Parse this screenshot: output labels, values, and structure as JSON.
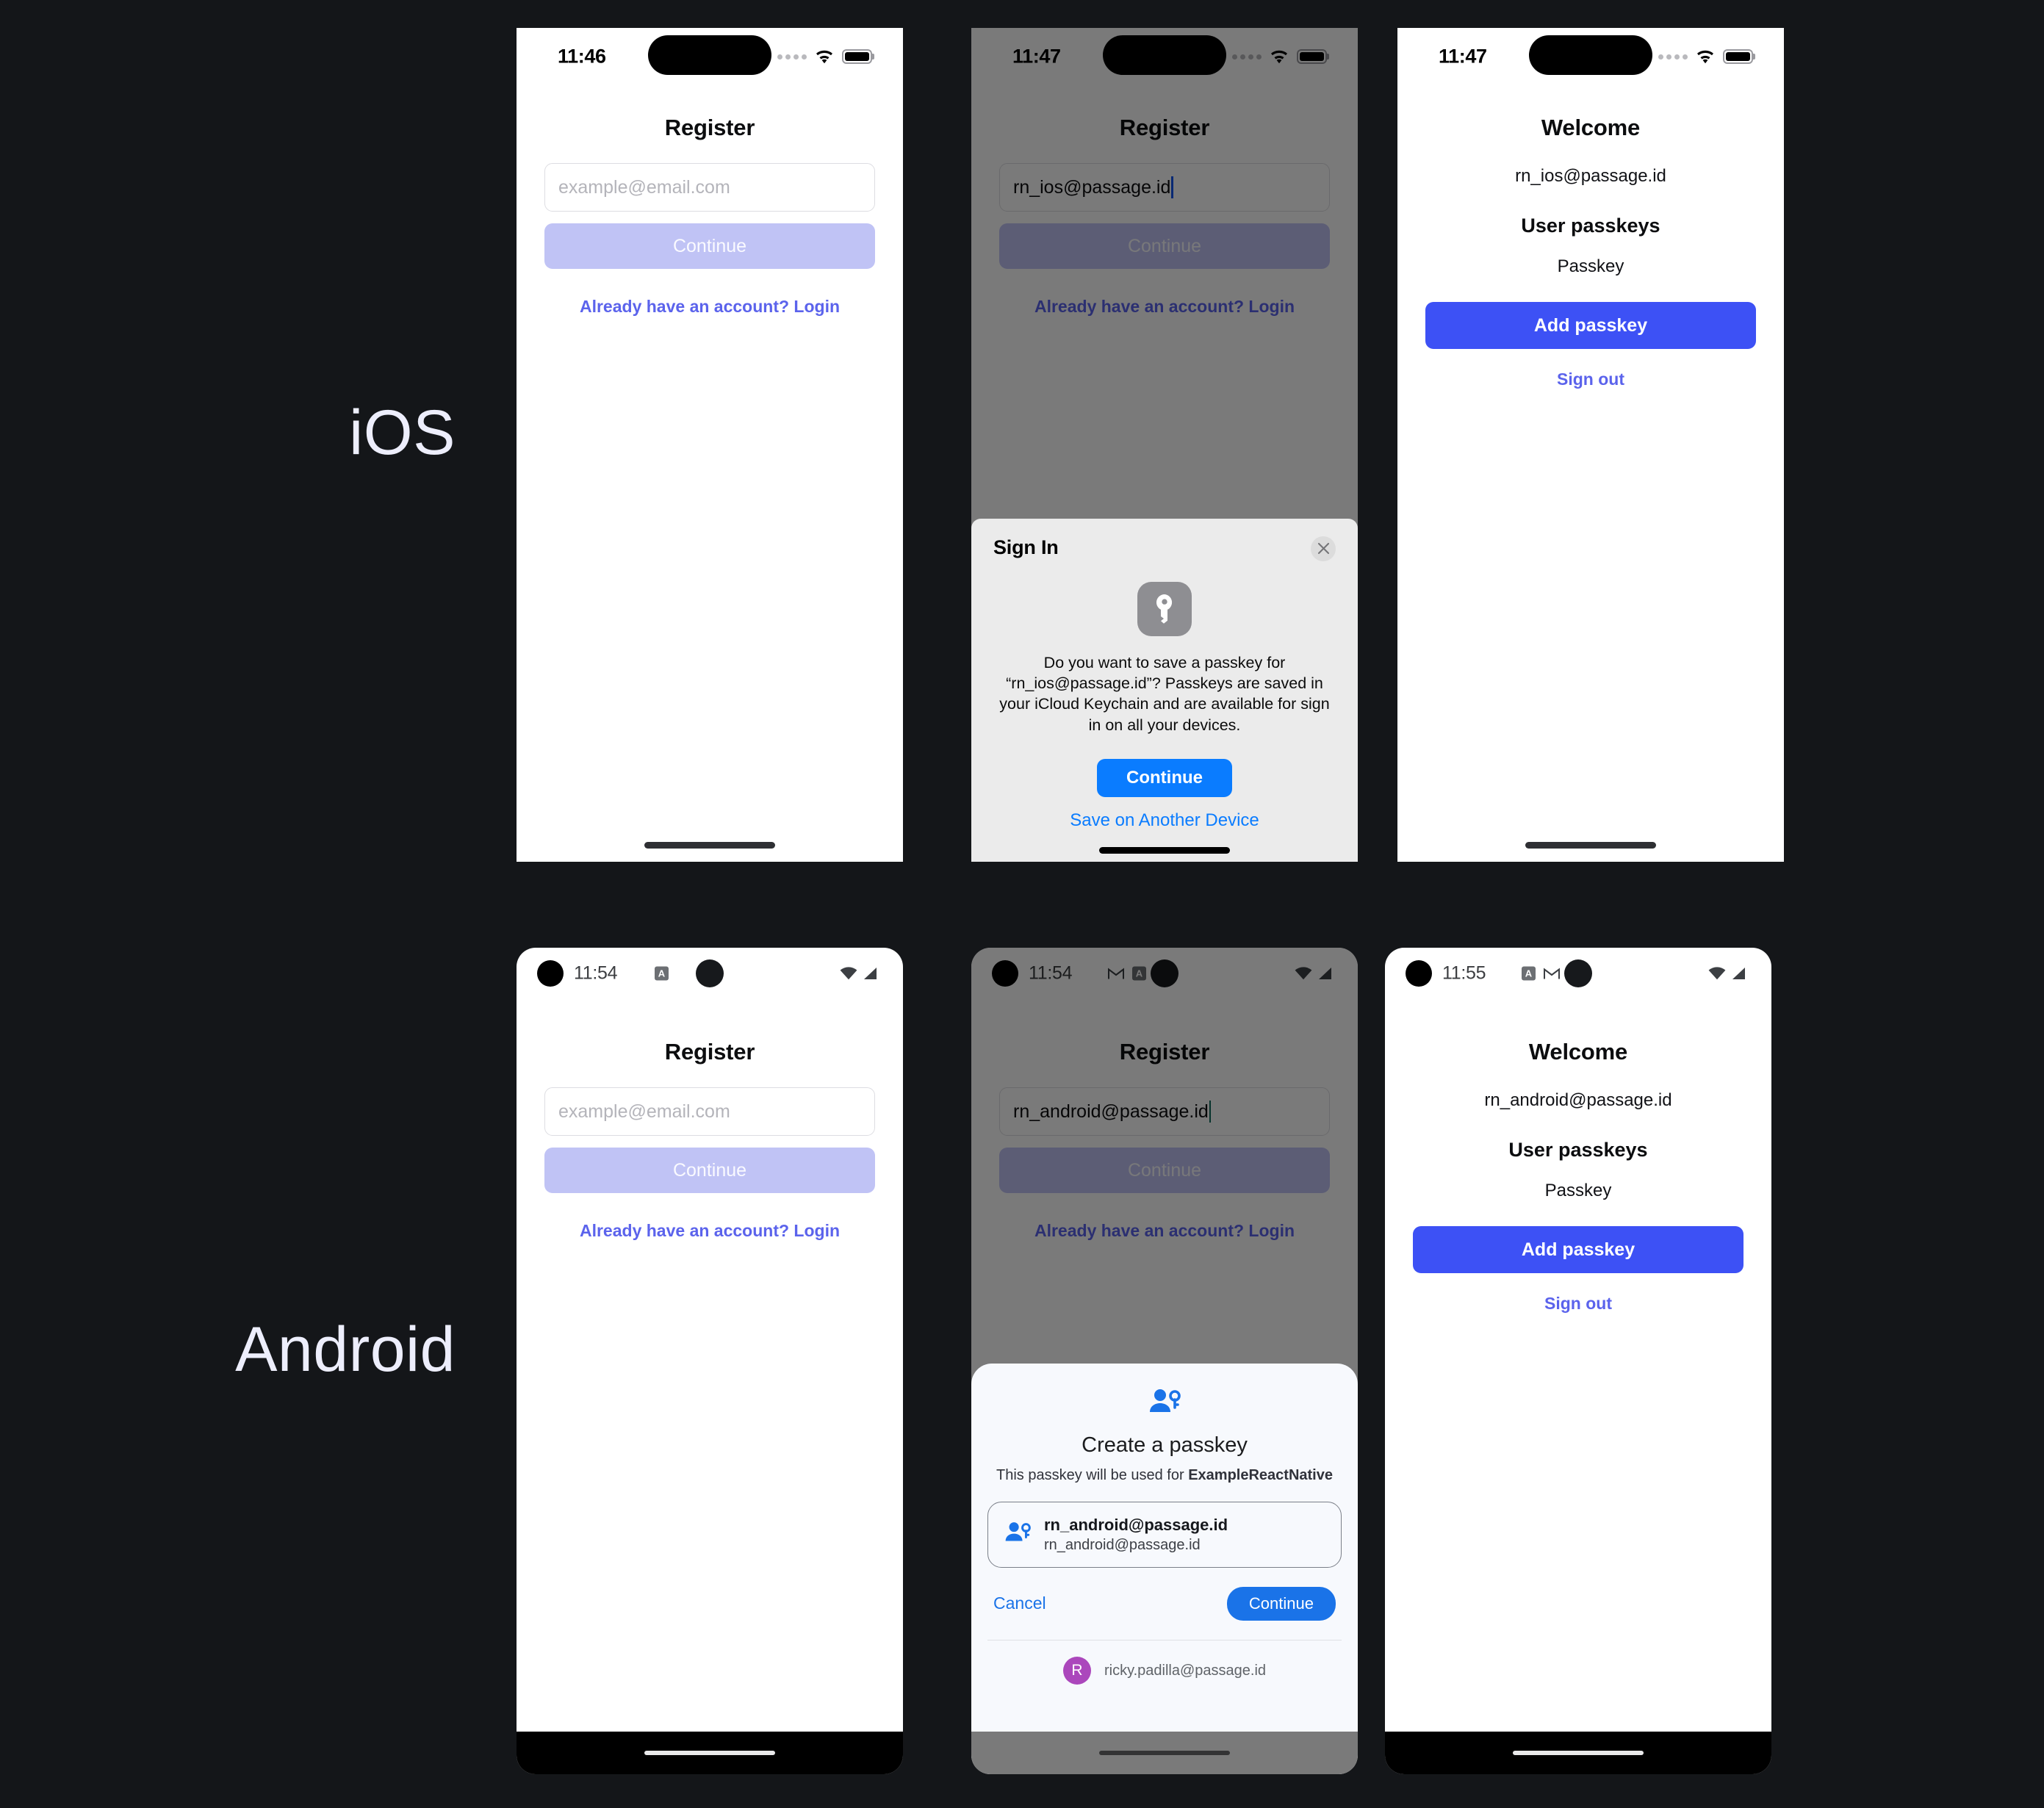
{
  "labels": {
    "ios": "iOS",
    "android": "Android"
  },
  "colors": {
    "page_background": "#141619",
    "primary_button": "#3d51f5",
    "disabled_button": "#c0c3f5",
    "link": "#5b63ec",
    "ios_blue": "#0a7cff",
    "android_blue": "#1a73e8",
    "avatar": "#ab47bc"
  },
  "ios": {
    "register_empty": {
      "status": {
        "time": "11:46",
        "wifi_icon": "wifi-icon",
        "battery_icon": "battery-icon",
        "cellular_icon": "cellular-dots-icon"
      },
      "title": "Register",
      "email_placeholder": "example@email.com",
      "email_value": "",
      "continue_label": "Continue",
      "login_link": "Already have an account? Login"
    },
    "register_filled": {
      "status": {
        "time": "11:47",
        "wifi_icon": "wifi-icon",
        "battery_icon": "battery-icon",
        "cellular_icon": "cellular-dots-icon"
      },
      "title": "Register",
      "email_placeholder": "example@email.com",
      "email_value": "rn_ios@passage.id",
      "continue_label": "Continue",
      "login_link": "Already have an account? Login",
      "sheet": {
        "title": "Sign In",
        "close_icon": "close-icon",
        "key_icon": "passkey-key-icon",
        "message": "Do you want to save a passkey for “rn_ios@passage.id”? Passkeys are saved in your iCloud Keychain and are available for sign in on all your devices.",
        "continue_label": "Continue",
        "alt_label": "Save on Another Device"
      }
    },
    "welcome": {
      "status": {
        "time": "11:47",
        "wifi_icon": "wifi-icon",
        "battery_icon": "battery-icon",
        "cellular_icon": "cellular-dots-icon"
      },
      "title": "Welcome",
      "email": "rn_ios@passage.id",
      "section_title": "User passkeys",
      "passkey_item": "Passkey",
      "add_passkey_label": "Add passkey",
      "sign_out_label": "Sign out"
    }
  },
  "android": {
    "register_empty": {
      "status": {
        "time": "11:54",
        "badges": [
          "app-badge-icon"
        ],
        "wifi_icon": "wifi-icon",
        "signal_icon": "signal-icon"
      },
      "title": "Register",
      "email_placeholder": "example@email.com",
      "email_value": "",
      "continue_label": "Continue",
      "login_link": "Already have an account? Login"
    },
    "register_filled": {
      "status": {
        "time": "11:54",
        "badges": [
          "gmail-icon",
          "app-badge-icon"
        ],
        "wifi_icon": "wifi-icon",
        "signal_icon": "signal-icon"
      },
      "title": "Register",
      "email_placeholder": "example@email.com",
      "email_value": "rn_android@passage.id",
      "continue_label": "Continue",
      "login_link": "Already have an account? Login",
      "sheet": {
        "icon": "person-key-icon",
        "title": "Create a passkey",
        "subtitle_prefix": "This passkey will be used for ",
        "subtitle_app": "ExampleReactNative",
        "account_name": "rn_android@passage.id",
        "account_sub": "rn_android@passage.id",
        "cancel_label": "Cancel",
        "continue_label": "Continue",
        "signed_in_initial": "R",
        "signed_in_email": "ricky.padilla@passage.id"
      }
    },
    "welcome": {
      "status": {
        "time": "11:55",
        "badges": [
          "app-badge-icon",
          "gmail-icon"
        ],
        "wifi_icon": "wifi-icon",
        "signal_icon": "signal-icon"
      },
      "title": "Welcome",
      "email": "rn_android@passage.id",
      "section_title": "User passkeys",
      "passkey_item": "Passkey",
      "add_passkey_label": "Add passkey",
      "sign_out_label": "Sign out"
    }
  }
}
